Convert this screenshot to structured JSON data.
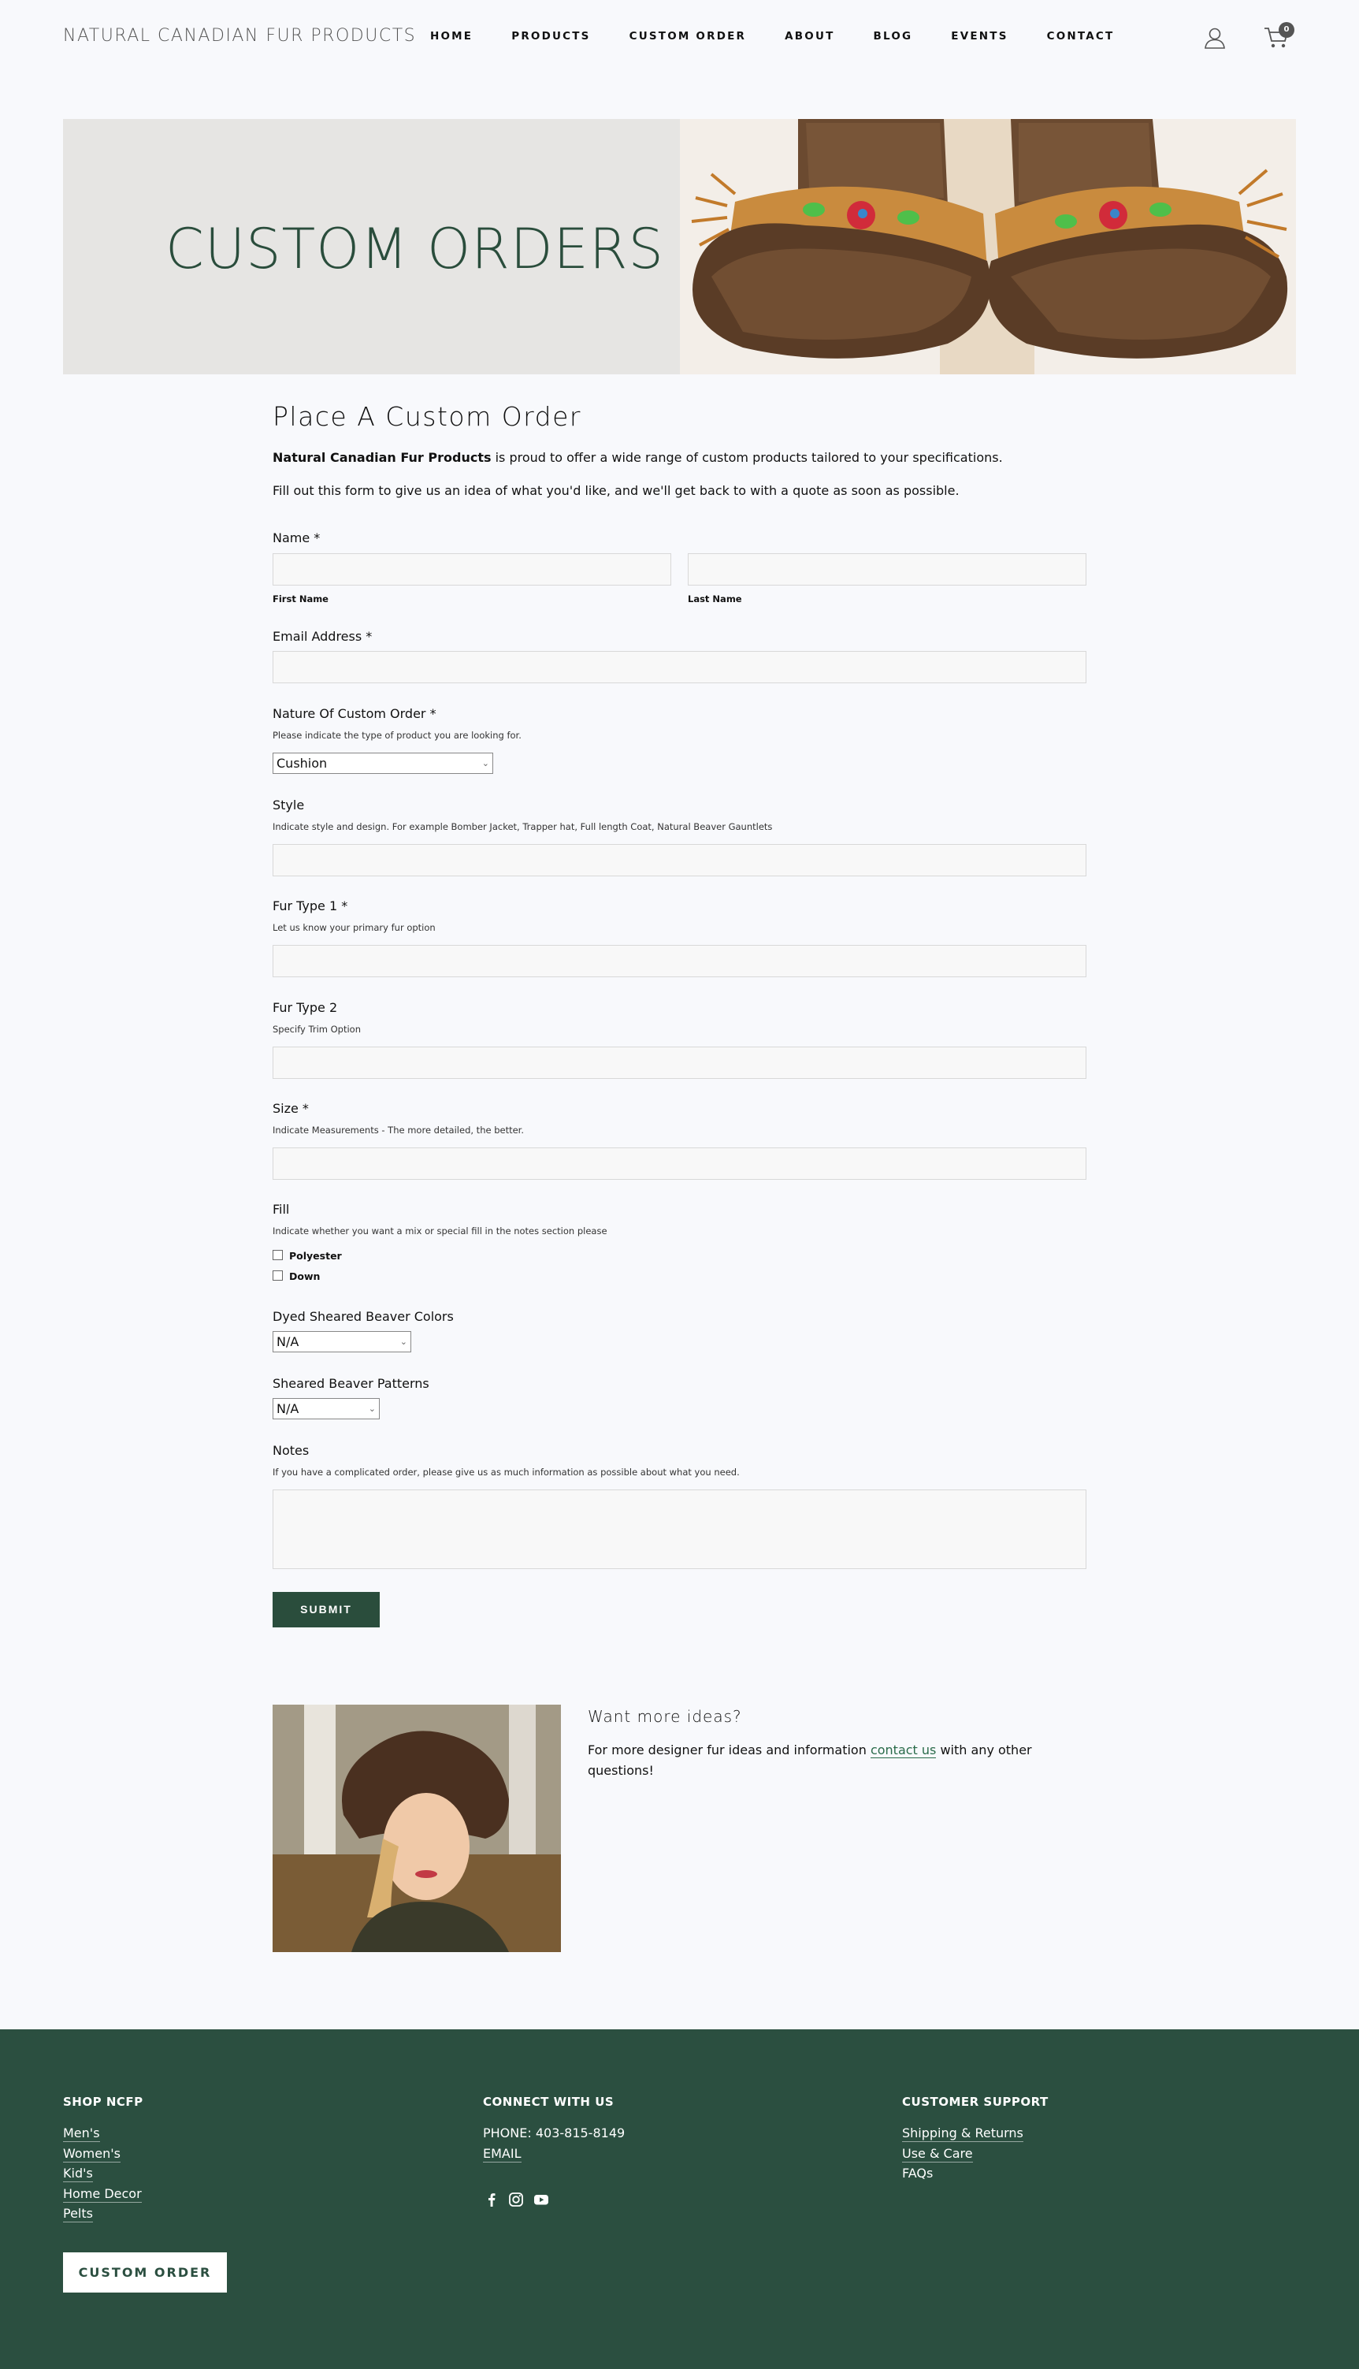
{
  "header": {
    "logo": "NATURAL CANADIAN FUR PRODUCTS",
    "nav": [
      "HOME",
      "PRODUCTS",
      "CUSTOM ORDER",
      "ABOUT",
      "BLOG",
      "EVENTS",
      "CONTACT"
    ],
    "cart_count": "0"
  },
  "hero": {
    "title": "CUSTOM ORDERS"
  },
  "form": {
    "heading": "Place A Custom Order",
    "intro_brand": "Natural Canadian Fur Products",
    "intro_rest": " is proud to offer a wide range of custom products tailored to your specifications.",
    "intro_2": "Fill out this form to give us an idea of what you'd like, and we'll get back to with a quote as soon as possible.",
    "name_label": "Name *",
    "first_name": "First Name",
    "last_name": "Last Name",
    "email_label": "Email Address *",
    "nature_label": "Nature Of Custom Order *",
    "nature_hint": "Please indicate the type of product you are looking for.",
    "nature_value": "Cushion",
    "style_label": "Style",
    "style_hint": "Indicate style and design. For example Bomber Jacket, Trapper hat, Full length Coat, Natural Beaver Gauntlets",
    "fur1_label": "Fur Type 1 *",
    "fur1_hint": "Let us know your primary fur option",
    "fur2_label": "Fur Type 2",
    "fur2_hint": "Specify Trim Option",
    "size_label": "Size *",
    "size_hint": "Indicate Measurements - The more detailed, the better.",
    "fill_label": "Fill",
    "fill_hint": "Indicate whether you want a mix or special fill in the notes section please",
    "fill_options": [
      "Polyester",
      "Down"
    ],
    "dyed_label": "Dyed Sheared Beaver Colors",
    "dyed_value": "N/A",
    "patterns_label": "Sheared Beaver Patterns",
    "patterns_value": "N/A",
    "notes_label": "Notes",
    "notes_hint": "If you have a complicated order, please give us as much information as possible about what you need.",
    "submit": "SUBMIT"
  },
  "ideas": {
    "title": "Want more ideas?",
    "text_before": "For more designer fur ideas and information ",
    "link": "contact us",
    "text_after": " with any other questions!"
  },
  "footer": {
    "shop_heading": "SHOP NCFP",
    "shop_links": [
      "Men's",
      "Women's",
      "Kid's",
      "Home Decor",
      "Pelts"
    ],
    "connect_heading": "CONNECT WITH US",
    "phone": "PHONE: 403-815-8149",
    "email": "EMAIL",
    "support_heading": "CUSTOMER SUPPORT",
    "support_links": [
      "Shipping & Returns",
      "Use & Care",
      "FAQs"
    ],
    "custom_order_button": "CUSTOM ORDER"
  }
}
